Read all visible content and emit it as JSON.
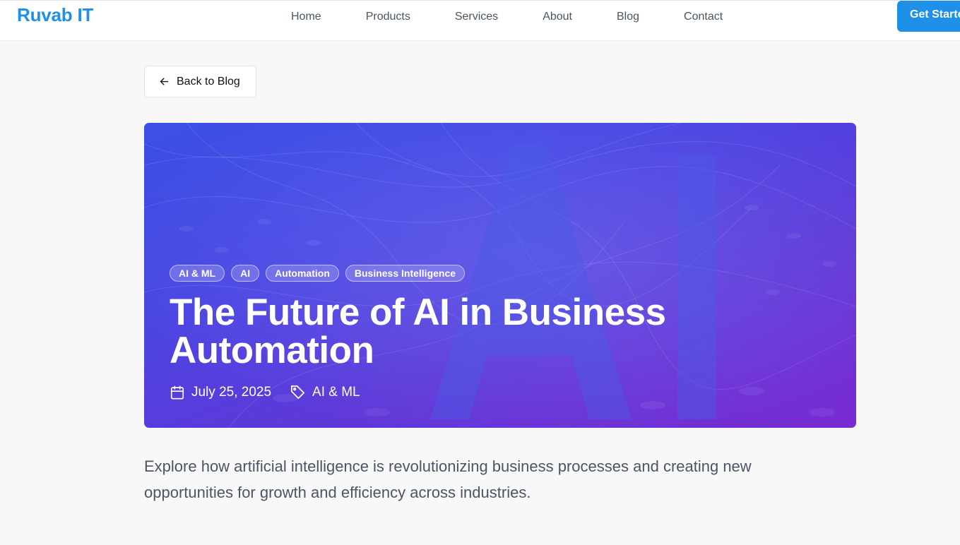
{
  "header": {
    "logo": "Ruvab IT",
    "nav": [
      "Home",
      "Products",
      "Services",
      "About",
      "Blog",
      "Contact"
    ],
    "cta_label": "Get Started"
  },
  "back_button": {
    "label": "Back to Blog",
    "icon": "arrow-left-icon"
  },
  "hero": {
    "background_text": "AI",
    "tags": [
      "AI & ML",
      "AI",
      "Automation",
      "Business Intelligence"
    ],
    "title": "The Future of AI in Business Automation",
    "date": "July 25, 2025",
    "category": "AI & ML",
    "date_icon": "calendar-icon",
    "category_icon": "tag-icon",
    "gradient_colors": [
      "#3b50e6",
      "#7a2bd3"
    ]
  },
  "excerpt": "Explore how artificial intelligence is revolutionizing business processes and creating new opportunities for growth and efficiency across industries.",
  "colors": {
    "brand": "#1e90e8",
    "page_background": "#f8f8f8",
    "nav_text": "#4b5563"
  }
}
